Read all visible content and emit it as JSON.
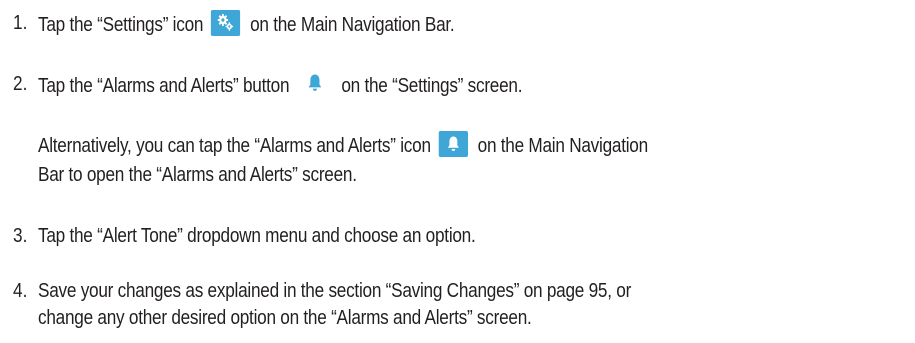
{
  "steps": [
    {
      "number": "1.",
      "before": "Tap the “Settings” icon",
      "icon": "gear-icon",
      "after": "on the Main Navigation Bar."
    },
    {
      "number": "2.",
      "before": "Tap the “Alarms and Alerts” button",
      "icon": "bell-icon",
      "after": "on the “Settings” screen.",
      "note": {
        "before": "Alternatively, you can tap the “Alarms and Alerts” icon",
        "icon": "bell-icon",
        "after": "on the Main Navigation",
        "line2": "Bar to open the “Alarms and Alerts” screen."
      }
    },
    {
      "number": "3.",
      "text": "Tap the “Alert Tone” dropdown menu and choose an option."
    },
    {
      "number": "4.",
      "line1": "Save your changes as explained in the section “Saving Changes” on page 95, or",
      "line2": "change any other desired option on the “Alarms and Alerts” screen."
    }
  ],
  "colors": {
    "text": "#231f20",
    "icon_bg": "#3fa6d8",
    "bell": "#3fa6d8"
  }
}
